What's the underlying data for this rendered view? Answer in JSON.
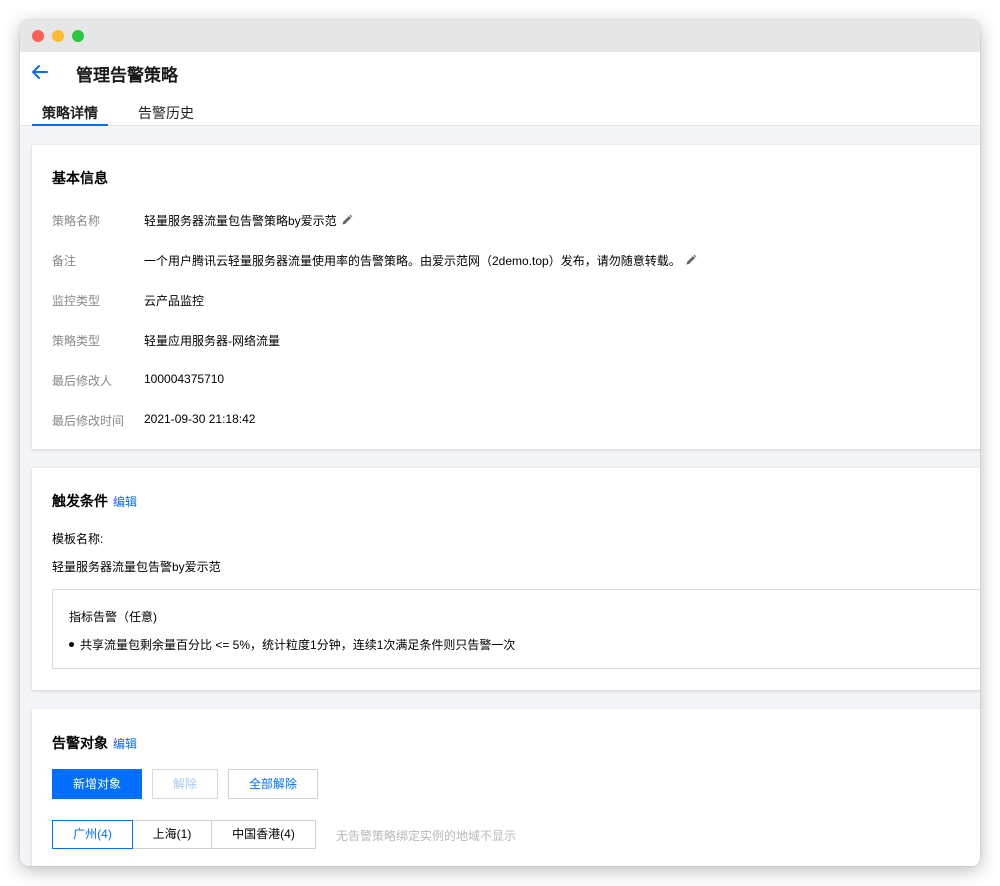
{
  "header": {
    "title": "管理告警策略",
    "tabs": [
      {
        "label": "策略详情",
        "active": true
      },
      {
        "label": "告警历史",
        "active": false
      }
    ]
  },
  "basic": {
    "title": "基本信息",
    "rows": [
      {
        "label": "策略名称",
        "value": "轻量服务器流量包告警策略by爱示范",
        "editable": true
      },
      {
        "label": "备注",
        "value": "一个用户腾讯云轻量服务器流量使用率的告警策略。由爱示范网（2demo.top）发布，请勿随意转载。",
        "editable": true
      },
      {
        "label": "监控类型",
        "value": "云产品监控",
        "editable": false
      },
      {
        "label": "策略类型",
        "value": "轻量应用服务器-网络流量",
        "editable": false
      },
      {
        "label": "最后修改人",
        "value": "100004375710",
        "editable": false
      },
      {
        "label": "最后修改时间",
        "value": "2021-09-30 21:18:42",
        "editable": false
      }
    ]
  },
  "trigger": {
    "title": "触发条件",
    "edit_label": "编辑",
    "template_label": "模板名称:",
    "template_value": "轻量服务器流量包告警by爱示范",
    "metric_title": "指标告警（任意)",
    "metric_item": "共享流量包剩余量百分比 <= 5%，统计粒度1分钟，连续1次满足条件则只告警一次"
  },
  "target": {
    "title": "告警对象",
    "edit_label": "编辑",
    "buttons": {
      "add": "新增对象",
      "remove": "解除",
      "remove_all": "全部解除"
    },
    "regions": [
      {
        "label": "广州(4)",
        "active": true
      },
      {
        "label": "上海(1)",
        "active": false
      },
      {
        "label": "中国香港(4)",
        "active": false
      }
    ],
    "note": "无告警策略绑定实例的地域不显示"
  },
  "colors": {
    "accent": "#006eff",
    "page_bg": "#f3f4f7",
    "label_gray": "#888888"
  },
  "icons": {
    "back": "arrow-left-icon",
    "edit": "pencil-icon"
  }
}
